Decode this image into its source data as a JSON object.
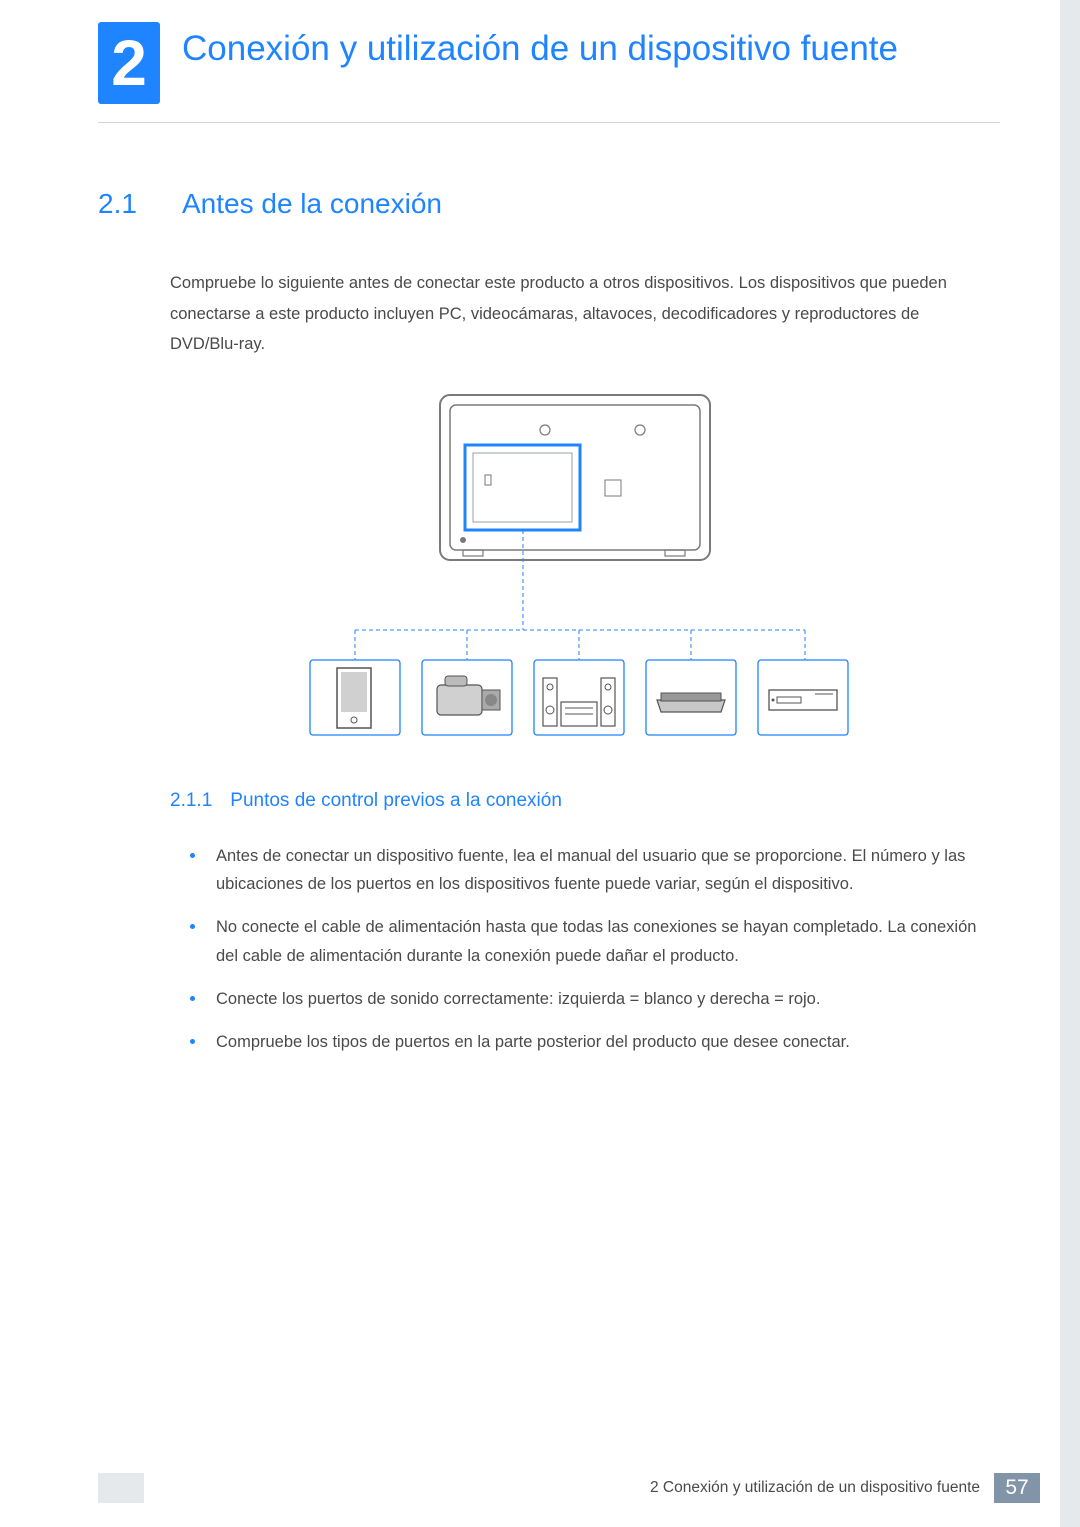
{
  "chapter": {
    "number": "2",
    "title": "Conexión y utilización de un dispositivo fuente"
  },
  "section": {
    "number": "2.1",
    "title": "Antes de la conexión",
    "intro": "Compruebe lo siguiente antes de conectar este producto a otros dispositivos. Los dispositivos que pueden conectarse a este producto incluyen PC, videocámaras, altavoces, decodificadores y reproductores de DVD/Blu-ray."
  },
  "subsection": {
    "number": "2.1.1",
    "title": "Puntos de control previos a la conexión",
    "bullets": [
      "Antes de conectar un dispositivo fuente, lea el manual del usuario que se proporcione. El número y las ubicaciones de los puertos en los dispositivos fuente puede variar, según el dispositivo.",
      "No conecte el cable de alimentación hasta que todas las conexiones se hayan completado. La conexión del cable de alimentación durante la conexión puede dañar el producto.",
      "Conecte los puertos de sonido correctamente: izquierda = blanco y derecha = rojo.",
      "Compruebe los tipos de puertos en la parte posterior del producto que desee conectar."
    ]
  },
  "footer": {
    "title": "2 Conexión y utilización de un dispositivo fuente",
    "page": "57"
  },
  "diagram": {
    "devices": [
      "pc-tower",
      "camcorder",
      "stereo-speakers",
      "set-top-box",
      "dvd-player"
    ]
  }
}
